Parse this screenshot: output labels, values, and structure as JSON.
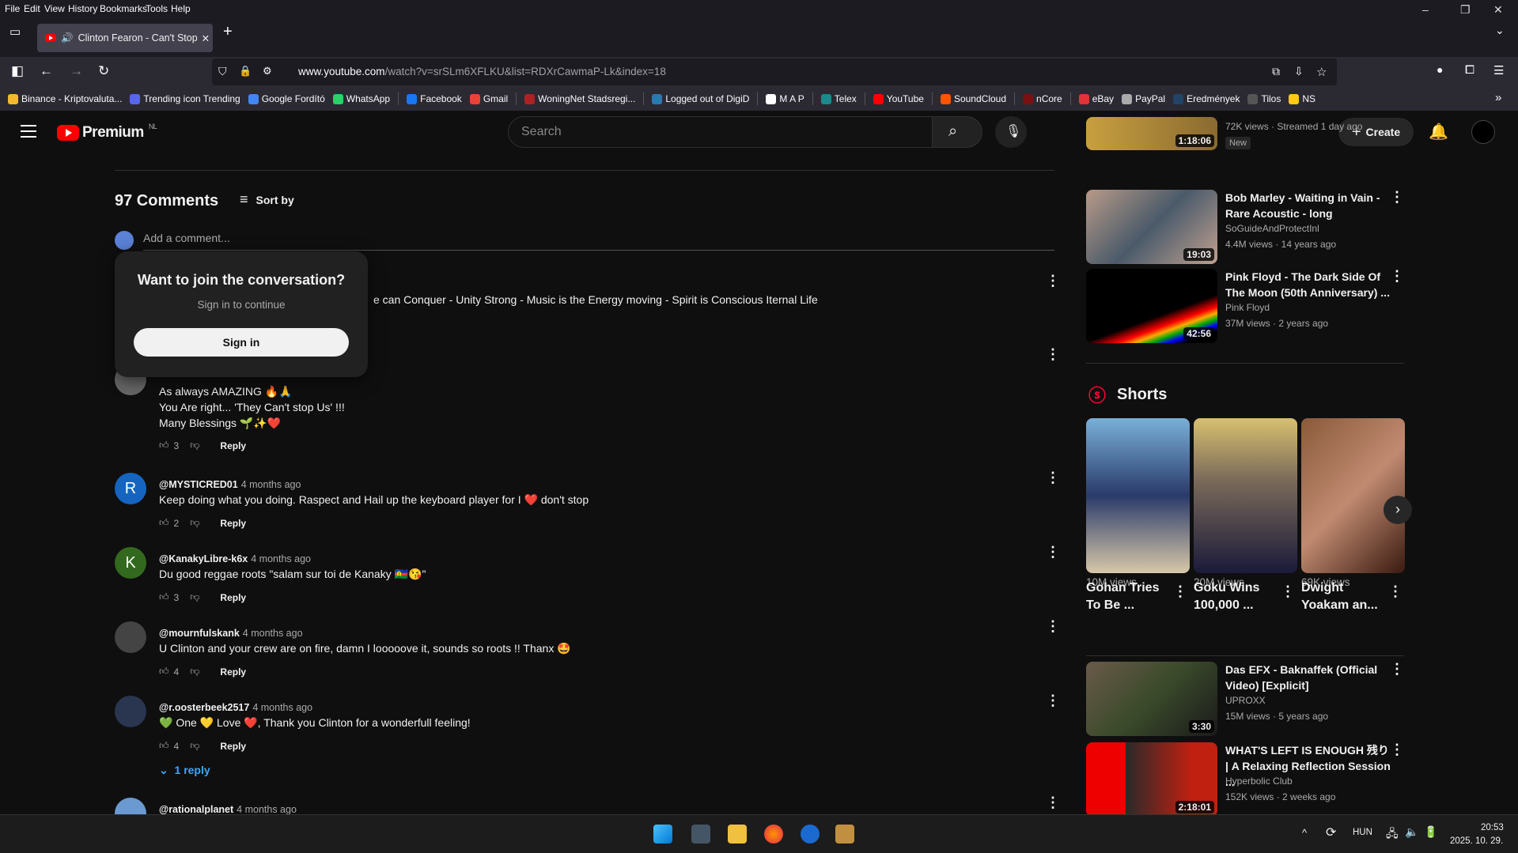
{
  "menu": [
    "File",
    "Edit",
    "View",
    "History",
    "Bookmarks",
    "Tools",
    "Help"
  ],
  "tab": {
    "title": "Clinton Fearon - Can't Stop"
  },
  "address": {
    "host": "www.youtube.com",
    "path": "/watch?v=srSLm6XFLKU&list=RDXrCawmaP-Lk&index=18"
  },
  "bookmarks": [
    {
      "label": "Binance - Kriptovaluta...",
      "color": "#f3ba2f"
    },
    {
      "label": "Trending icon  Trending",
      "color": "#5865f2"
    },
    {
      "label": "Google Fordító",
      "color": "#4285f4"
    },
    {
      "label": "WhatsApp",
      "color": "#25d366"
    },
    {
      "label": "Facebook",
      "color": "#1877f2"
    },
    {
      "label": "Gmail",
      "color": "#ea4335"
    },
    {
      "label": "WoningNet Stadsregi...",
      "color": "#a22"
    },
    {
      "label": "Logged out of DigiD",
      "color": "#2a7ab0"
    },
    {
      "label": "M A P",
      "color": "#fff"
    },
    {
      "label": "Telex",
      "color": "#1a8a8a"
    },
    {
      "label": "YouTube",
      "color": "#f00"
    },
    {
      "label": "SoundCloud",
      "color": "#f50"
    },
    {
      "label": "nCore",
      "color": "#7a1010"
    },
    {
      "label": "eBay",
      "color": "#e53238"
    },
    {
      "label": "PayPal",
      "color": "#aaa"
    },
    {
      "label": "Eredmények",
      "color": "#246"
    },
    {
      "label": "Tilos",
      "color": "#555"
    },
    {
      "label": "NS",
      "color": "#ffc917"
    }
  ],
  "yt": {
    "logo": "Premium",
    "region": "NL",
    "search_placeholder": "Search",
    "create": "Create"
  },
  "comments_header": {
    "count": "97 Comments",
    "sort": "Sort by",
    "add_placeholder": "Add a comment..."
  },
  "popup": {
    "title": "Want to join the conversation?",
    "subtitle": "Sign in to continue",
    "button": "Sign in"
  },
  "partial_comments": [
    {
      "text": "e can Conquer - Unity Strong - Music is the Energy moving - Spirit is Conscious Iternal Life"
    },
    {
      "lines": [
        "As always AMAZING 🔥🙏",
        "You Are right... 'They Can't stop Us' !!!",
        "Many Blessings 🌱✨❤️"
      ],
      "likes": "3",
      "reply": "Reply"
    }
  ],
  "comments": [
    {
      "author": "@MYSTICRED01",
      "time": "4 months ago",
      "text": "Keep doing what you doing.  Raspect and Hail up the keyboard player for I ❤️ don't stop",
      "likes": "2",
      "reply": "Reply",
      "initial": "R",
      "color": "#1565c0"
    },
    {
      "author": "@KanakyLibre-k6x",
      "time": "4 months ago",
      "text": "Du good reggae roots \"salam sur toi de Kanaky 🇳🇨😘\"",
      "likes": "3",
      "reply": "Reply",
      "initial": "K",
      "color": "#33691e"
    },
    {
      "author": "@mournfulskank",
      "time": "4 months ago",
      "text": "U Clinton and your crew are on fire, damn I looooove it, sounds so roots !! Thanx 🤩",
      "likes": "4",
      "reply": "Reply",
      "initial": "",
      "color": "#444"
    },
    {
      "author": "@r.oosterbeek2517",
      "time": "4 months ago",
      "text": "💚 One 💛 Love ❤️, Thank you Clinton for a wonderfull feeling!",
      "likes": "4",
      "reply": "Reply",
      "initial": "",
      "color": "#2a3550"
    },
    {
      "author": "@rationalplanet",
      "time": "4 months ago",
      "text": "",
      "likes": "",
      "reply": "",
      "initial": "",
      "color": "#6a9ad0"
    }
  ],
  "one_reply": "1 reply",
  "related_top": {
    "meta": "72K views · Streamed 1 day ago",
    "badge": "New",
    "duration": "1:18:06"
  },
  "related": [
    {
      "title": "Bob Marley - Waiting in Vain - Rare Acoustic - long",
      "channel": "SoGuideAndProtectInl",
      "meta": "4.4M views · 14 years ago",
      "duration": "19:03",
      "bg": "linear-gradient(135deg,#b89a88,#4a5a6a 50%,#c0a090)"
    },
    {
      "title": "Pink Floyd - The Dark Side Of The Moon (50th Anniversary) ...",
      "channel": "Pink Floyd",
      "meta": "37M views · 2 years ago",
      "duration": "42:56",
      "bg": "linear-gradient(160deg,#000 60%,#f00 70%,#fa0 75%,#0a0 80%,#00f 85%,#000 90%)"
    }
  ],
  "shorts": {
    "title": "Shorts",
    "items": [
      {
        "title": "Gohan Tries To Be ...",
        "views": "10M views",
        "bg": "linear-gradient(#7ab0d8,#2a3a6a 50%,#d8c8a8)"
      },
      {
        "title": "Goku Wins 100,000 ...",
        "views": "20M views",
        "bg": "linear-gradient(#d8c070,#7a6a5a 40%,#1a1a3a)"
      },
      {
        "title": "Dwight Yoakam an...",
        "views": "69K views",
        "bg": "linear-gradient(135deg,#8a5a3a,#c08a70 50%,#3a1a10)"
      }
    ]
  },
  "related2": [
    {
      "title": "Das EFX - Baknaffek (Official Video) [Explicit]",
      "channel": "UPROXX",
      "meta": "15M views · 5 years ago",
      "duration": "3:30",
      "bg": "linear-gradient(135deg,#6a5a4a,#3a4a2a 50%,#1a1a1a)"
    },
    {
      "title": "WHAT'S LEFT IS ENOUGH 残り | A Relaxing Reflection Session ...",
      "channel": "Hyperbolic Club",
      "meta": "152K views · 2 weeks ago",
      "duration": "2:18:01",
      "bg": "linear-gradient(90deg,#e00 30%,#2a2a2a 30%,#c02010 80%)"
    }
  ],
  "tray": {
    "lang": "HUN",
    "time": "20:53",
    "date": "2025. 10. 29."
  }
}
